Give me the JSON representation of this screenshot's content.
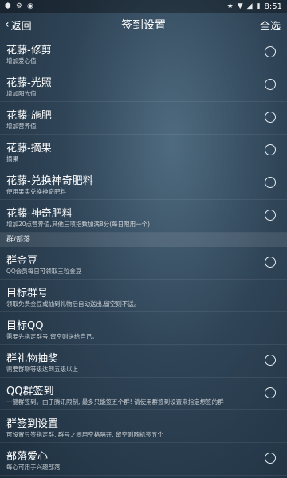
{
  "status": {
    "time": "8:51"
  },
  "header": {
    "back_label": "返回",
    "title": "签到设置",
    "select_all": "全选"
  },
  "items_top": [
    {
      "title": "花藤-修剪",
      "subtitle": "增加爱心值",
      "radio": true
    },
    {
      "title": "花藤-光照",
      "subtitle": "增加阳光值",
      "radio": true
    },
    {
      "title": "花藤-施肥",
      "subtitle": "增加营养值",
      "radio": true
    },
    {
      "title": "花藤-摘果",
      "subtitle": "摘果",
      "radio": true
    },
    {
      "title": "花藤-兑换神奇肥料",
      "subtitle": "使用果实兑换神奇肥料",
      "radio": true
    },
    {
      "title": "花藤-神奇肥料",
      "subtitle": "增加20点营养值,其他三项指数加满8分(每日限用一个)",
      "radio": true
    }
  ],
  "section_label": "群/部落",
  "items_bottom": [
    {
      "title": "群金豆",
      "subtitle": "QQ会员每日可领取三粒金豆",
      "radio": true
    },
    {
      "title": "目标群号",
      "subtitle": "领取免费金豆或抽到礼物后自动送出,留空则不送。",
      "radio": false
    },
    {
      "title": "目标QQ",
      "subtitle": "需要先指定群号,留空则送给自己。",
      "radio": false
    },
    {
      "title": "群礼物抽奖",
      "subtitle": "需要群聊等级达到五级以上",
      "radio": true
    },
    {
      "title": "QQ群签到",
      "subtitle": "一键群签到。由于腾讯限制, 最多只能签五个群! 请使用群签到设置来指定想签的群",
      "radio": true
    },
    {
      "title": "群签到设置",
      "subtitle": "可设置只签指定群, 群号之间用空格隔开, 留空则随机签五个",
      "radio": false
    },
    {
      "title": "部落爱心",
      "subtitle": "每心可用于兴趣部落",
      "radio": true
    }
  ]
}
